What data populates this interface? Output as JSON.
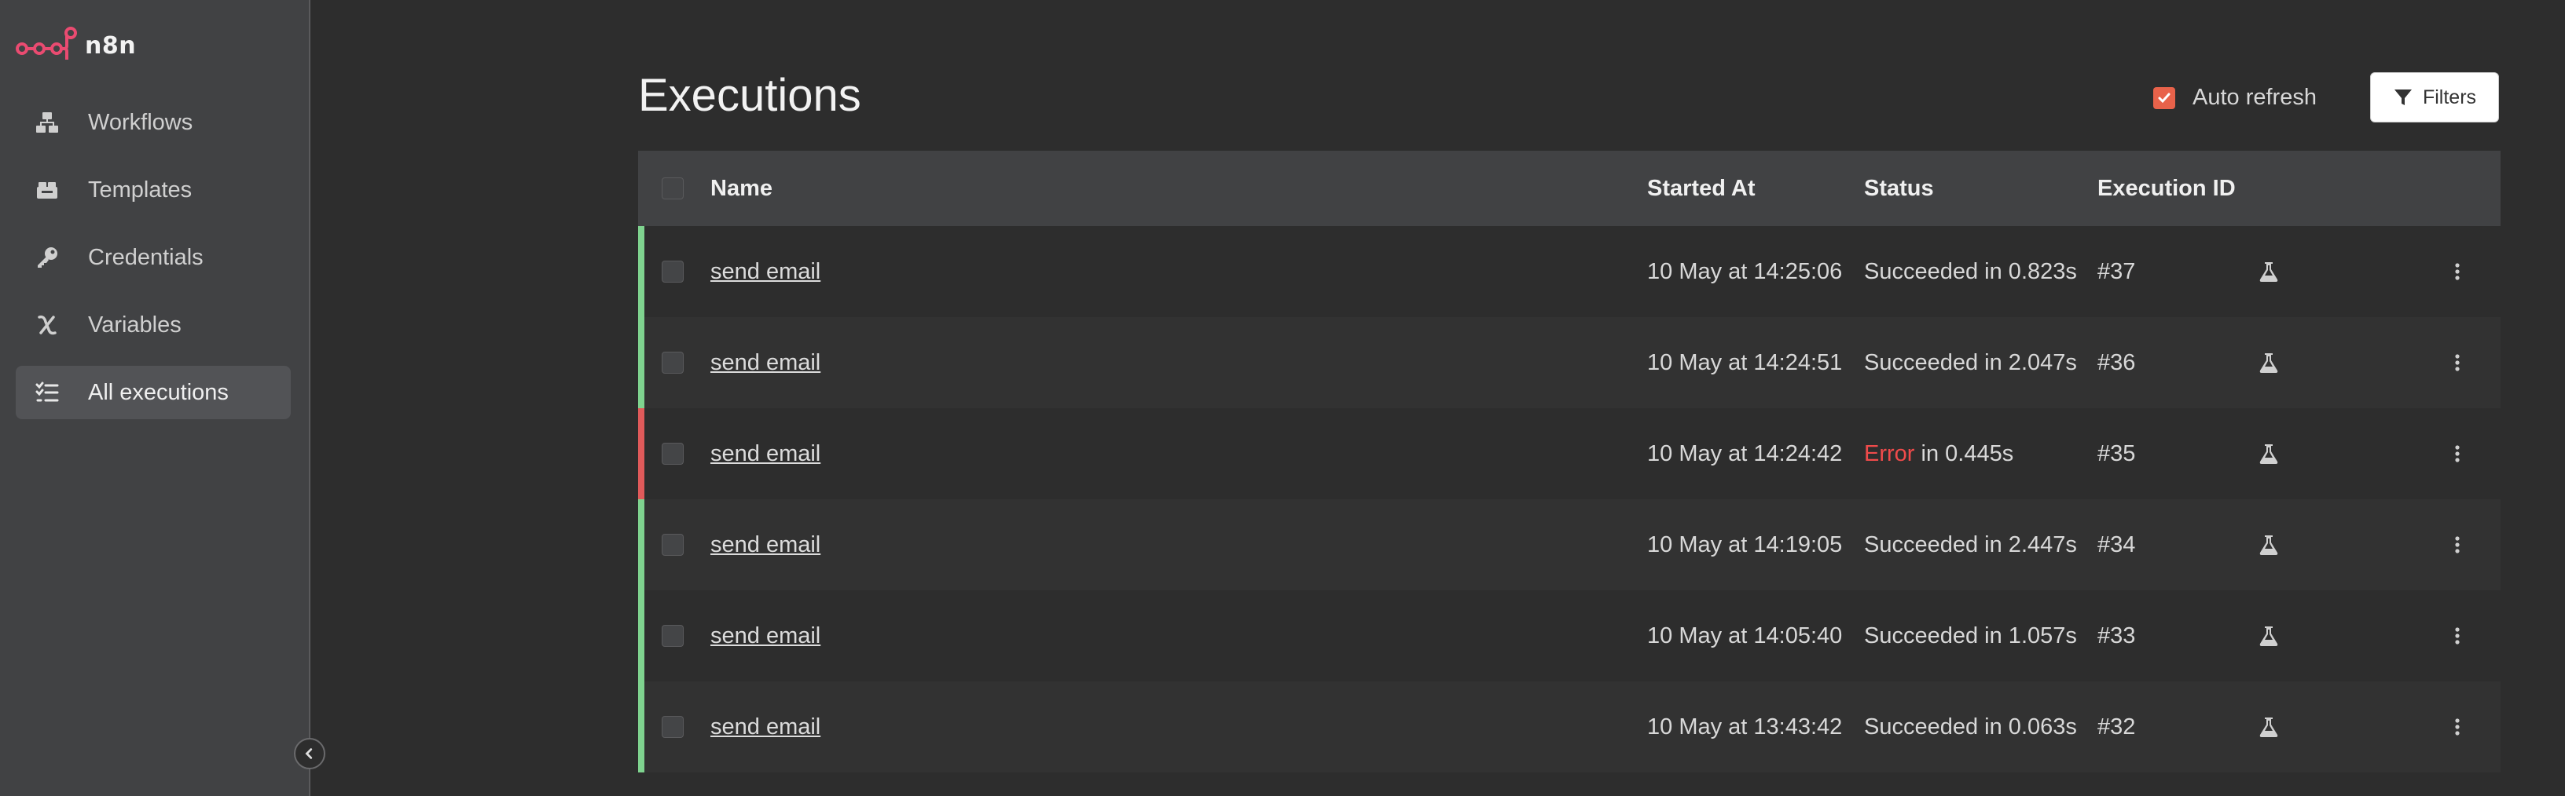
{
  "app": {
    "logo_text": "n8n"
  },
  "sidebar": {
    "items": [
      {
        "label": "Workflows",
        "icon": "workflows-icon"
      },
      {
        "label": "Templates",
        "icon": "templates-icon"
      },
      {
        "label": "Credentials",
        "icon": "key-icon"
      },
      {
        "label": "Variables",
        "icon": "variables-icon"
      },
      {
        "label": "All executions",
        "icon": "list-check-icon",
        "active": true
      }
    ]
  },
  "page": {
    "title": "Executions",
    "auto_refresh_label": "Auto refresh",
    "auto_refresh_checked": true,
    "filters_label": "Filters"
  },
  "table": {
    "headers": {
      "name": "Name",
      "started_at": "Started At",
      "status": "Status",
      "execution_id": "Execution ID"
    },
    "rows": [
      {
        "name": "send email",
        "started_at": "10 May at 14:25:06",
        "status_word": "Succeeded",
        "status_rest": " in 0.823s",
        "state": "success",
        "id": "#37"
      },
      {
        "name": "send email",
        "started_at": "10 May at 14:24:51",
        "status_word": "Succeeded",
        "status_rest": " in 2.047s",
        "state": "success",
        "id": "#36"
      },
      {
        "name": "send email",
        "started_at": "10 May at 14:24:42",
        "status_word": "Error",
        "status_rest": " in 0.445s",
        "state": "error",
        "id": "#35"
      },
      {
        "name": "send email",
        "started_at": "10 May at 14:19:05",
        "status_word": "Succeeded",
        "status_rest": " in 2.447s",
        "state": "success",
        "id": "#34"
      },
      {
        "name": "send email",
        "started_at": "10 May at 14:05:40",
        "status_word": "Succeeded",
        "status_rest": " in 1.057s",
        "state": "success",
        "id": "#33"
      },
      {
        "name": "send email",
        "started_at": "10 May at 13:43:42",
        "status_word": "Succeeded",
        "status_rest": " in 0.063s",
        "state": "success",
        "id": "#32"
      }
    ]
  },
  "colors": {
    "accent": "#e8624a",
    "success": "#7fd38f",
    "error": "#e05a5a",
    "error_text": "#f04b4b"
  }
}
